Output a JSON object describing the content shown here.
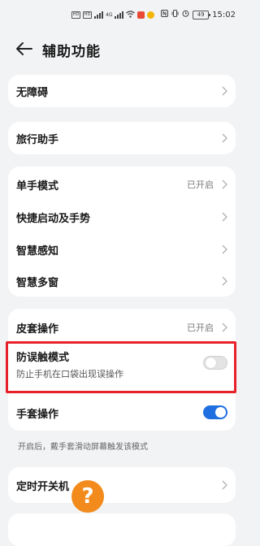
{
  "status_bar": {
    "sim1": "HD",
    "sim2": "HD",
    "signal_label": "4G",
    "battery": "49",
    "time": "15:02"
  },
  "header": {
    "title": "辅助功能"
  },
  "accessibility": {
    "label": "无障碍"
  },
  "travel_assistant": {
    "label": "旅行助手"
  },
  "group_one_hand": {
    "one_hand_mode": {
      "label": "单手模式",
      "value": "已开启"
    },
    "shortcuts_gestures": {
      "label": "快捷启动及手势"
    },
    "smart_sensing": {
      "label": "智慧感知"
    },
    "smart_multiwindow": {
      "label": "智慧多窗"
    }
  },
  "group_cover": {
    "cover_operation": {
      "label": "皮套操作",
      "value": "已开启"
    },
    "accidental_touch": {
      "label": "防误触模式",
      "description": "防止手机在口袋出现误操作",
      "enabled": false
    },
    "glove_mode": {
      "label": "手套操作",
      "enabled": true,
      "hint": "开启后，戴手套滑动屏幕触发该模式"
    }
  },
  "scheduled_power": {
    "label": "定时开关机"
  },
  "colors": {
    "accent": "#1f6fe0",
    "highlight_box": "#e8202a",
    "background": "#f1f3f5"
  }
}
